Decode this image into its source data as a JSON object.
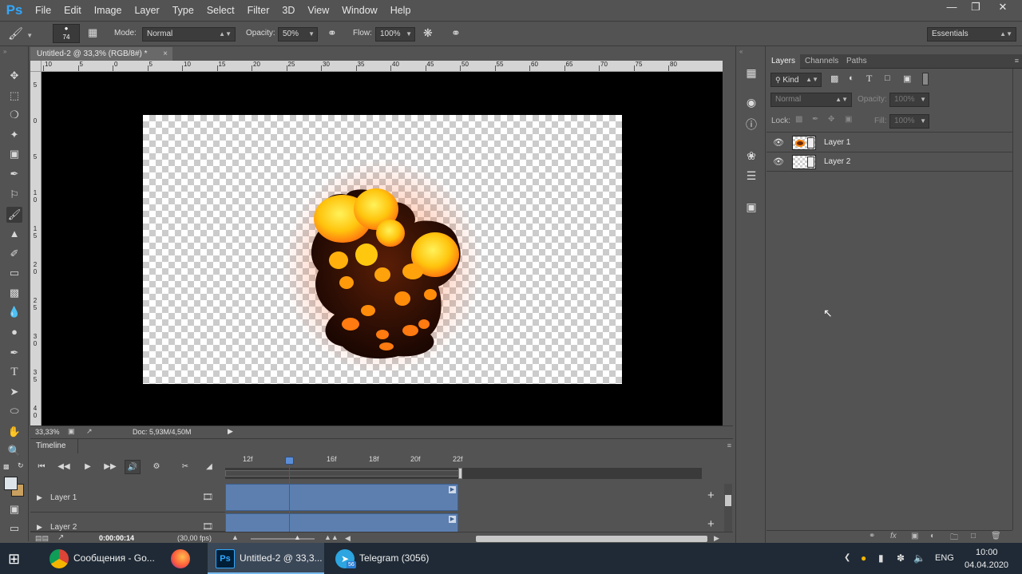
{
  "app": {
    "logo": "Ps",
    "menu": [
      "File",
      "Edit",
      "Image",
      "Layer",
      "Type",
      "Select",
      "Filter",
      "3D",
      "View",
      "Window",
      "Help"
    ],
    "window_controls": [
      "minimize-icon",
      "restore-icon",
      "close-icon"
    ]
  },
  "options": {
    "brush_size": "74",
    "mode_label": "Mode:",
    "mode_value": "Normal",
    "opacity_label": "Opacity:",
    "opacity_value": "50%",
    "flow_label": "Flow:",
    "flow_value": "100%",
    "workspace": "Essentials"
  },
  "document": {
    "tab_title": "Untitled-2 @ 33,3% (RGB/8#) *",
    "zoom": "33,33%",
    "doc_info": "Doc: 5,93M/4,50M",
    "ruler_top": [
      "10",
      "5",
      "0",
      "5",
      "10",
      "15",
      "20",
      "25",
      "30",
      "35",
      "40",
      "45",
      "50",
      "55",
      "60",
      "65",
      "70",
      "75",
      "80"
    ],
    "ruler_left": [
      "5",
      "0",
      "5",
      "1 0",
      "1 5",
      "2 0",
      "2 5",
      "3 0",
      "3 5",
      "4 0"
    ]
  },
  "timeline": {
    "title": "Timeline",
    "frames": [
      "12f",
      "14f",
      "16f",
      "18f",
      "20f",
      "22f"
    ],
    "layers": [
      "Layer 1",
      "Layer 2"
    ],
    "current_time": "0:00:00:14",
    "fps": "(30,00 fps)"
  },
  "layers_panel": {
    "tabs": [
      "Layers",
      "Channels",
      "Paths"
    ],
    "kind_label": "Kind",
    "blend_mode": "Normal",
    "opacity_label": "Opacity:",
    "opacity_value": "100%",
    "lock_label": "Lock:",
    "fill_label": "Fill:",
    "fill_value": "100%",
    "layers": [
      {
        "name": "Layer 1",
        "visible": true
      },
      {
        "name": "Layer 2",
        "visible": true
      }
    ]
  },
  "taskbar": {
    "apps": [
      {
        "label": "Сообщения - Go...",
        "icon": "chrome-icon"
      },
      {
        "label": "",
        "icon": "firefox-icon"
      },
      {
        "label": "Untitled-2 @ 33,3...",
        "icon": "photoshop-icon"
      },
      {
        "label": "Telegram (3056)",
        "icon": "telegram-icon"
      }
    ],
    "telegram_badge": "56",
    "language": "ENG",
    "time": "10:00",
    "date": "04.04.2020"
  },
  "colors": {
    "accent_blue": "#31a8ff",
    "clip_blue": "#5c7fb0",
    "playhead_red": "#e02020",
    "explosion_yellow": "#ffd21a",
    "explosion_orange": "#ff7a10"
  }
}
